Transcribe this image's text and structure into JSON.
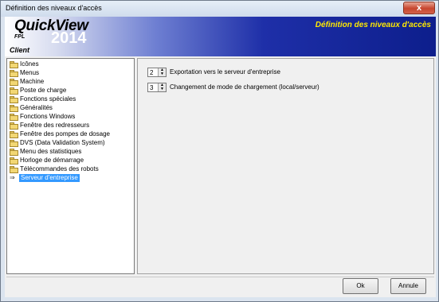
{
  "window": {
    "title": "Définition des niveaux d'accès",
    "close_label": "x"
  },
  "banner": {
    "logo_quickview": "QuickView",
    "logo_fpl": "FPL",
    "logo_year": "2014",
    "logo_client": "Client",
    "heading": "Définition des niveaux d'accès"
  },
  "tree": {
    "items": [
      {
        "label": "Icônes",
        "icon": "folder-icon"
      },
      {
        "label": "Menus",
        "icon": "folder-icon"
      },
      {
        "label": "Machine",
        "icon": "folder-icon"
      },
      {
        "label": "Poste de charge",
        "icon": "folder-icon"
      },
      {
        "label": "Fonctions spéciales",
        "icon": "folder-icon"
      },
      {
        "label": "Généralités",
        "icon": "folder-icon"
      },
      {
        "label": "Fonctions Windows",
        "icon": "folder-icon"
      },
      {
        "label": "Fenêtre des redresseurs",
        "icon": "folder-icon"
      },
      {
        "label": "Fenêtre des pompes de dosage",
        "icon": "folder-icon"
      },
      {
        "label": "DVS (Data Validation System)",
        "icon": "folder-icon"
      },
      {
        "label": "Menu des statistiques",
        "icon": "folder-icon"
      },
      {
        "label": "Horloge de démarrage",
        "icon": "folder-icon"
      },
      {
        "label": "Télécommandes des robots",
        "icon": "folder-icon"
      },
      {
        "label": "Serveur d'entreprise",
        "icon": "arrow-icon",
        "selected": true
      }
    ]
  },
  "settings": [
    {
      "value": "2",
      "label": "Exportation vers le serveur d'entreprise"
    },
    {
      "value": "3",
      "label": "Changement de mode de chargement (local/serveur)"
    }
  ],
  "buttons": {
    "ok": "Ok",
    "cancel": "Annule"
  },
  "colors": {
    "selection": "#3399ff",
    "banner_title": "#ffe900",
    "banner_dark": "#0d1e8c"
  }
}
